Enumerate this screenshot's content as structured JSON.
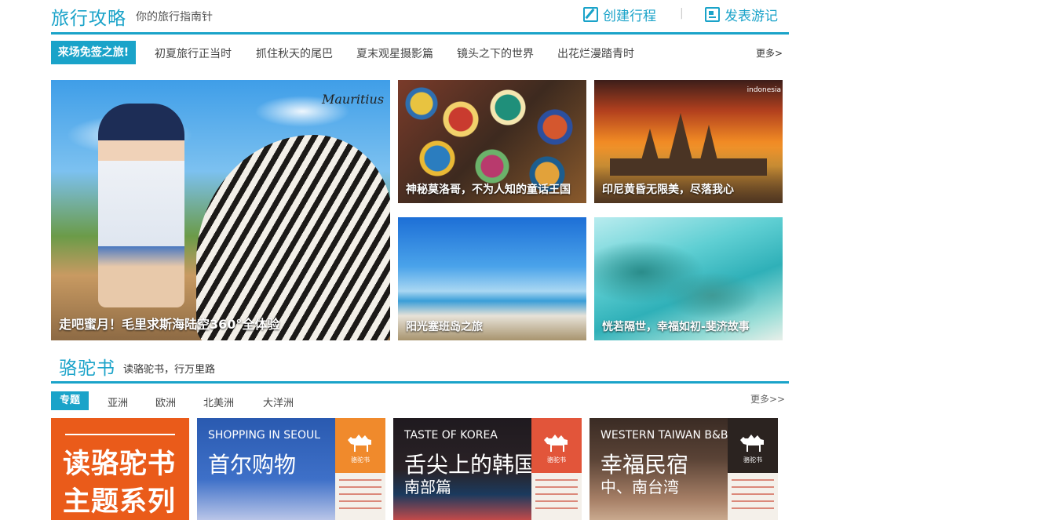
{
  "travel": {
    "title": "旅行攻略",
    "subtitle": "你的旅行指南针",
    "actions": {
      "create": "创建行程",
      "publish": "发表游记",
      "separator": "|"
    },
    "highlight_tag": "来场免签之旅!",
    "tags": [
      "初夏旅行正当时",
      "抓住秋天的尾巴",
      "夏末观星摄影篇",
      "镜头之下的世界",
      "出花烂漫踏青时"
    ],
    "more": "更多>",
    "tiles": {
      "big": {
        "caption": "走吧蜜月！毛里求斯海陆空360°全体验",
        "logo": "Mauritius"
      },
      "t1": {
        "caption": "神秘莫洛哥，不为人知的童话王国"
      },
      "t2": {
        "caption": "印尼黄昏无限美，尽落我心",
        "logo": "indonesia"
      },
      "t3": {
        "caption": "阳光塞班岛之旅"
      },
      "t4": {
        "caption": "恍若隔世，幸福如初-斐济故事"
      }
    }
  },
  "luotuo": {
    "title": "骆驼书",
    "subtitle": "读骆驼书，行万里路",
    "highlight_cat": "专题",
    "cats": [
      "亚洲",
      "欧洲",
      "北美洲",
      "大洋洲"
    ],
    "more": "更多>>",
    "books": {
      "b1": {
        "line1": "读骆驼书",
        "line2": "主题系列"
      },
      "b2": {
        "en": "SHOPPING IN SEOUL",
        "cn": "首尔购物",
        "badge": "骆驼书"
      },
      "b3": {
        "en": "TASTE OF KOREA",
        "cn": "舌尖上的韩国",
        "cn2": "南部篇",
        "badge": "骆驼书"
      },
      "b4": {
        "en": "WESTERN TAIWAN B&B",
        "cn": "幸福民宿",
        "cn2": "中、南台湾",
        "badge": "骆驼书"
      }
    }
  },
  "colors": {
    "accent": "#1aa3c9",
    "book_orange": "#ea5b1a"
  }
}
